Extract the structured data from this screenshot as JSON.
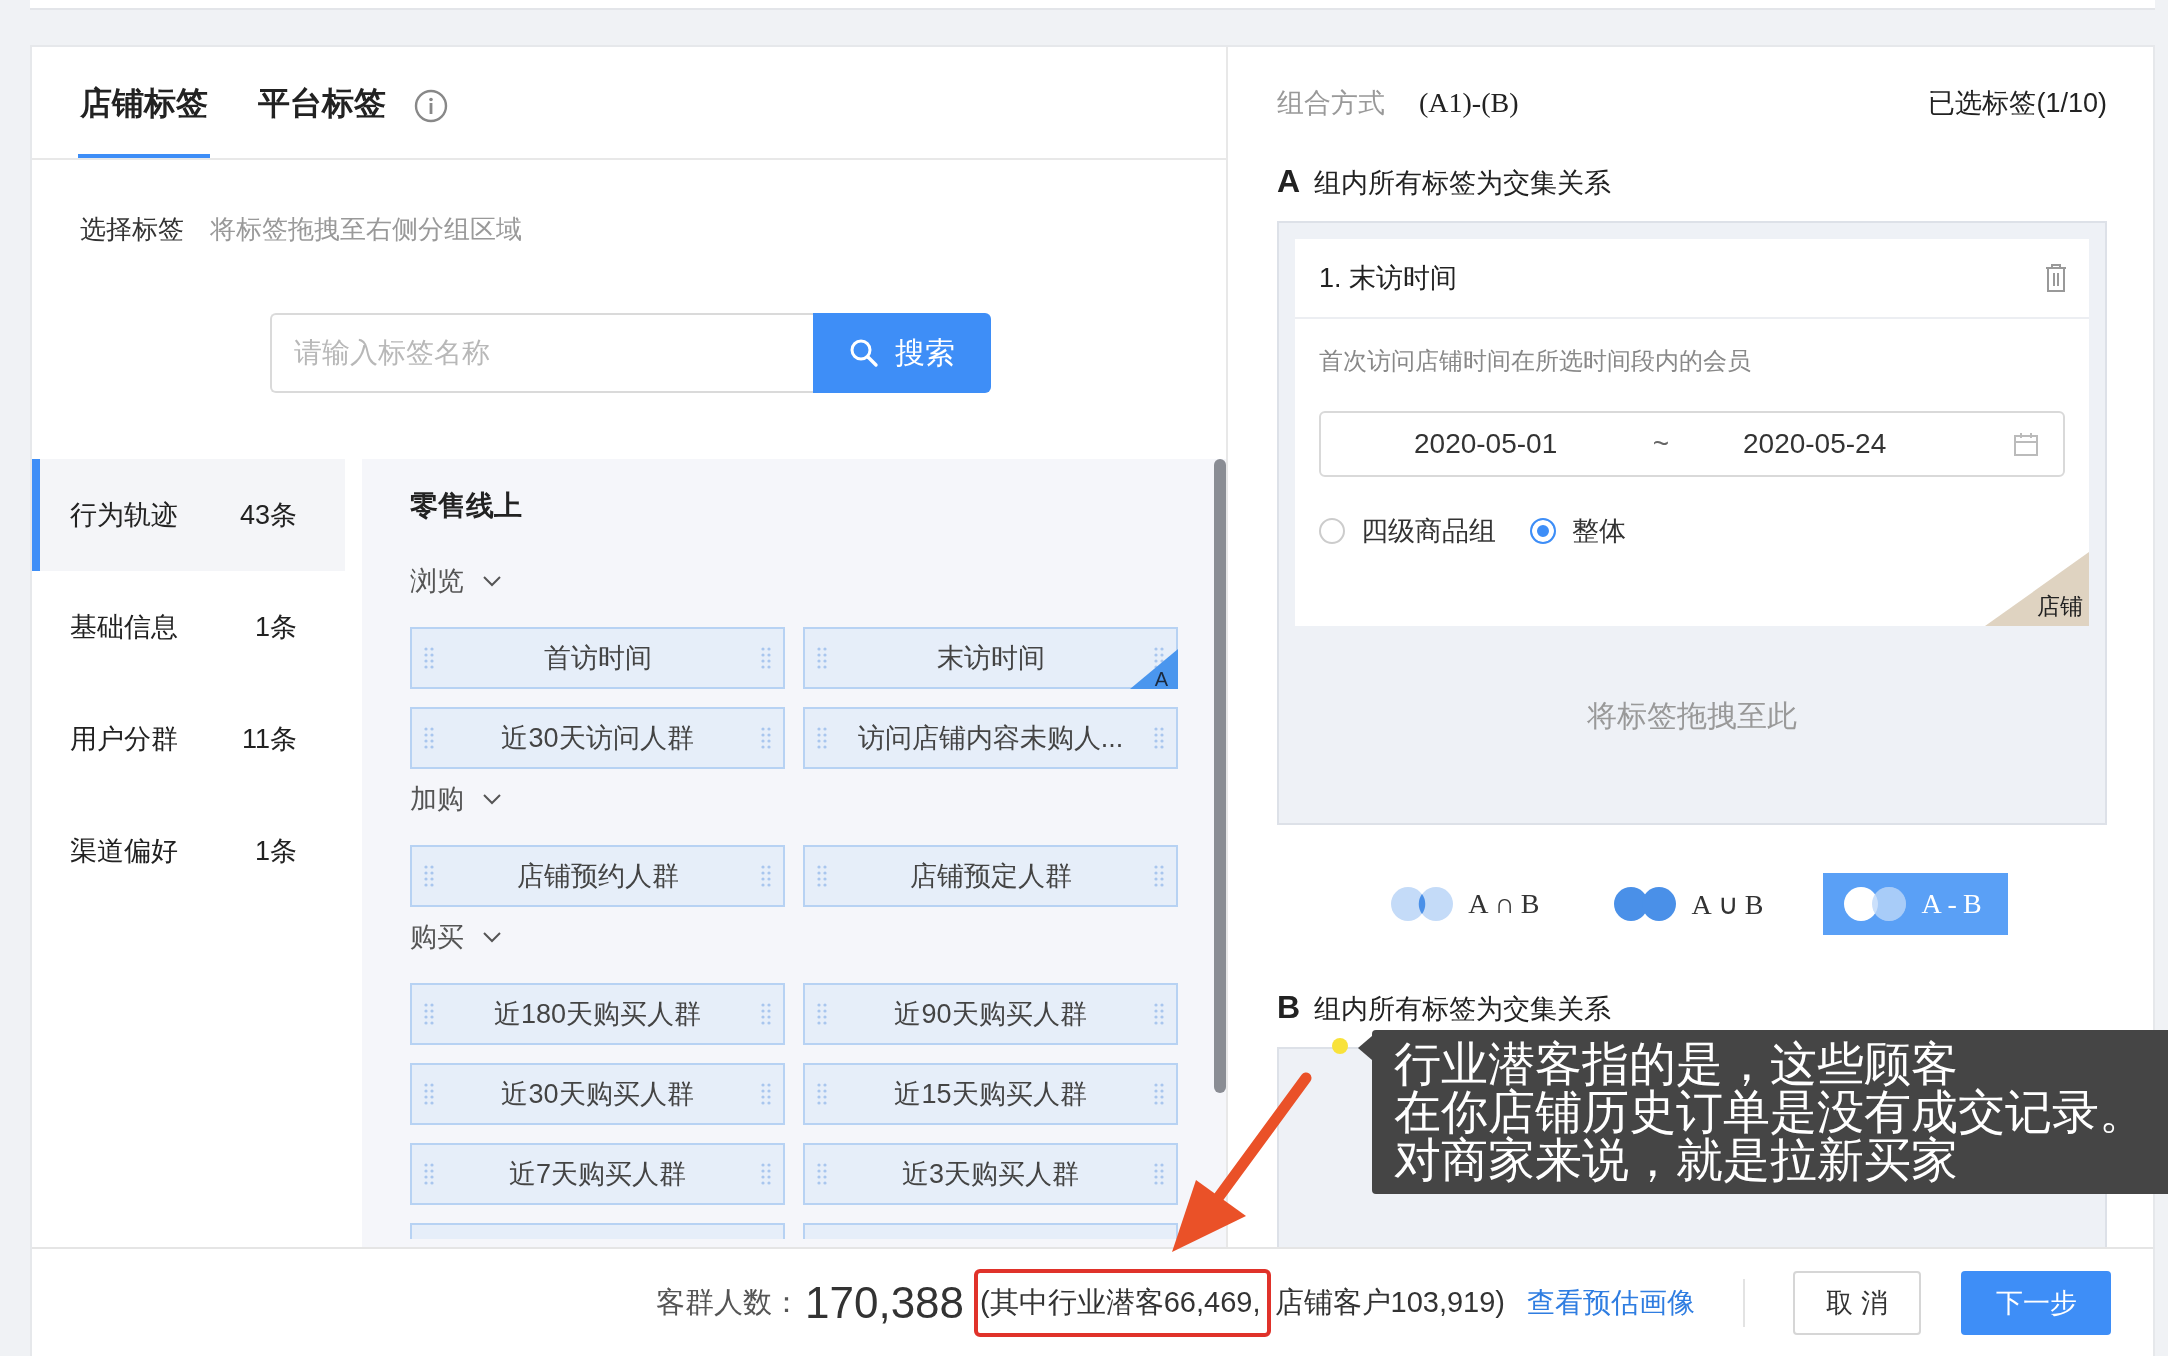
{
  "tabs": [
    {
      "label": "店铺标签",
      "selected": true
    },
    {
      "label": "平台标签",
      "selected": false
    }
  ],
  "select_hint": {
    "label": "选择标签",
    "hint": "将标签拖拽至右侧分组区域"
  },
  "search": {
    "placeholder": "请输入标签名称",
    "button": "搜索"
  },
  "categories": [
    {
      "name": "行为轨迹",
      "count": "43条",
      "selected": true
    },
    {
      "name": "基础信息",
      "count": "1条",
      "selected": false
    },
    {
      "name": "用户分群",
      "count": "11条",
      "selected": false
    },
    {
      "name": "渠道偏好",
      "count": "1条",
      "selected": false
    }
  ],
  "tag_panel": {
    "title": "零售线上",
    "groups": [
      {
        "name": "浏览",
        "expanded": true,
        "tags": [
          {
            "kind": "tag",
            "label": "首访时间"
          },
          {
            "kind": "tag",
            "label": "末访时间",
            "badge": "A"
          },
          {
            "kind": "tag",
            "label": "近30天访问人群"
          },
          {
            "kind": "tag",
            "label": "访问店铺内容未购人..."
          }
        ]
      },
      {
        "name": "加购",
        "expanded": true,
        "tags": [
          {
            "kind": "tag",
            "label": "店铺预约人群"
          },
          {
            "kind": "tag",
            "label": "店铺预定人群"
          }
        ]
      },
      {
        "name": "购买",
        "expanded": true,
        "tags": [
          {
            "kind": "tag",
            "label": "近180天购买人群"
          },
          {
            "kind": "tag",
            "label": "近90天购买人群"
          },
          {
            "kind": "tag",
            "label": "近30天购买人群"
          },
          {
            "kind": "tag",
            "label": "近15天购买人群"
          },
          {
            "kind": "tag",
            "label": "近7天购买人群"
          },
          {
            "kind": "tag",
            "label": "近3天购买人群"
          },
          {
            "kind": "clipped"
          },
          {
            "kind": "clipped"
          }
        ]
      }
    ]
  },
  "combination": {
    "label": "组合方式",
    "formula": "(A1)-(B)",
    "selected_count": "已选标签(1/10)"
  },
  "group_a": {
    "letter": "A",
    "title": "组内所有标签为交集关系",
    "conditions": [
      {
        "title": "1. 末访时间",
        "description": "首次访问店铺时间在所选时间段内的会员",
        "date_from": "2020-05-01",
        "separator": "~",
        "date_to": "2020-05-24",
        "options": [
          {
            "label": "四级商品组",
            "selected": false
          },
          {
            "label": "整体",
            "selected": true
          }
        ],
        "corner_label": "店铺"
      }
    ],
    "drop_hint": "将标签拖拽至此"
  },
  "operations": [
    {
      "label": "A∩B",
      "kind": "intersect",
      "selected": false
    },
    {
      "label": "A∪B",
      "kind": "union",
      "selected": false
    },
    {
      "label": "A-B",
      "kind": "difference",
      "selected": true
    }
  ],
  "group_b": {
    "letter": "B",
    "title": "组内所有标签为交集关系"
  },
  "footer": {
    "count_label": "客群人数：",
    "count": "170,388",
    "breakdown_1": "(其中行业潜客66,469,",
    "breakdown_2": "店铺客户103,919)",
    "link": "查看预估画像",
    "buttons": [
      {
        "label": "取 消",
        "kind": "secondary"
      },
      {
        "label": "下一步",
        "kind": "primary"
      }
    ]
  },
  "annotation": {
    "lines": [
      "行业潜客指的是，这些顾客",
      "在你店铺历史订单是没有成交记录。",
      "对商家来说，就是拉新买家"
    ]
  }
}
